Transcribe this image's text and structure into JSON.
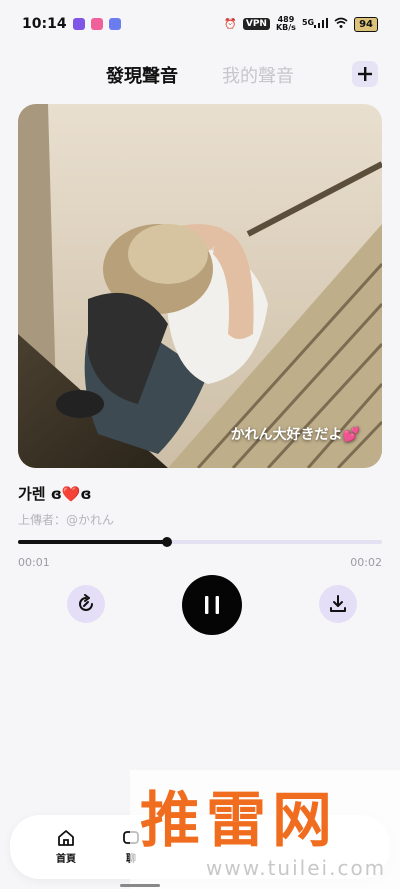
{
  "status_bar": {
    "time": "10:14",
    "vpn": "VPN",
    "net_speed_top": "489",
    "net_speed_unit": "KB/s",
    "signal": "5G",
    "battery": "94",
    "app_icon_colors": [
      "#7e55e6",
      "#f0609a",
      "#6b7bf0"
    ]
  },
  "header": {
    "tab_discover": "發現聲音",
    "tab_mine": "我的聲音",
    "add_icon": "plus-icon"
  },
  "cover": {
    "caption": "かれん大好きだよ💕"
  },
  "track": {
    "title": "가렌 ɞ❤️ɞ",
    "uploader": "上傳者：@かれん",
    "current_time": "00:01",
    "total_time": "00:02",
    "progress_percent": 41
  },
  "controls": {
    "replay_icon": "replay-icon",
    "pause_icon": "pause-icon",
    "download_icon": "download-icon"
  },
  "bottom_nav": {
    "home_label": "首頁",
    "second_label": "聊"
  },
  "watermark": {
    "brand": "推雷网",
    "url": "www.tuilei.com"
  },
  "colors": {
    "accent_soft": "#e4def7",
    "primary": "#050505",
    "watermark": "#f06d1f"
  }
}
